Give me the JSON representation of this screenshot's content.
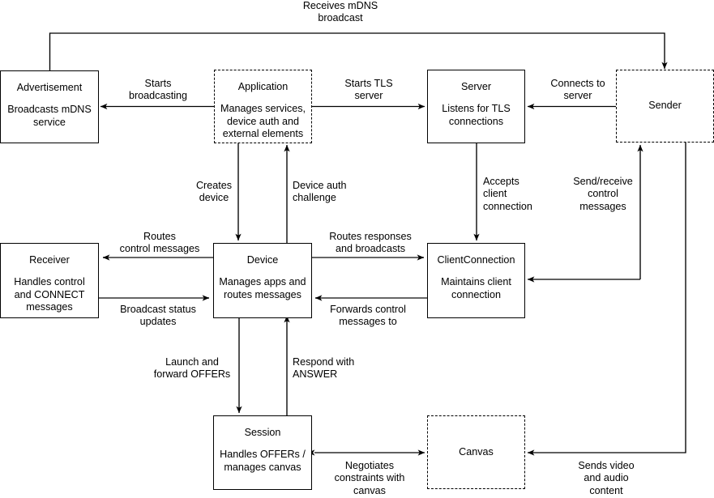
{
  "diagram": {
    "title": "Component interaction diagram",
    "colors": {
      "node_border": "#000000",
      "background": "#ffffff",
      "text": "#000000",
      "edge_black": "#000000",
      "edge_gray": "#666666"
    },
    "nodes": [
      {
        "id": "advertisement",
        "title": "Advertisement",
        "subtitle": "Broadcasts mDNS\nservice",
        "style": "solid"
      },
      {
        "id": "application",
        "title": "Application",
        "subtitle": "Manages services,\ndevice auth and\nexternal elements",
        "style": "dashed"
      },
      {
        "id": "server",
        "title": "Server",
        "subtitle": "Listens for TLS\nconnections",
        "style": "solid"
      },
      {
        "id": "sender",
        "title": "Sender",
        "subtitle": "",
        "style": "dashed"
      },
      {
        "id": "receiver",
        "title": "Receiver",
        "subtitle": "Handles control\nand CONNECT\nmessages",
        "style": "solid"
      },
      {
        "id": "device",
        "title": "Device",
        "subtitle": "Manages apps and\nroutes messages",
        "style": "solid"
      },
      {
        "id": "clientconnection",
        "title": "ClientConnection",
        "subtitle": "Maintains client\nconnection",
        "style": "solid"
      },
      {
        "id": "session",
        "title": "Session",
        "subtitle": "Handles OFFERs  /\nmanages canvas",
        "style": "solid"
      },
      {
        "id": "canvas",
        "title": "Canvas",
        "subtitle": "",
        "style": "dashed"
      }
    ],
    "edges": [
      {
        "id": "e1",
        "from": "advertisement",
        "to": "sender",
        "label": "Receives mDNS\nbroadcast"
      },
      {
        "id": "e2",
        "from": "application",
        "to": "advertisement",
        "label": "Starts\nbroadcasting"
      },
      {
        "id": "e3",
        "from": "application",
        "to": "server",
        "label": "Starts TLS\nserver"
      },
      {
        "id": "e4",
        "from": "sender",
        "to": "server",
        "label": "Connects to\nserver"
      },
      {
        "id": "e5",
        "from": "application",
        "to": "device",
        "label": "Creates\ndevice"
      },
      {
        "id": "e6",
        "from": "device",
        "to": "application",
        "label": "Device auth\nchallenge"
      },
      {
        "id": "e7",
        "from": "server",
        "to": "clientconnection",
        "label": "Accepts\nclient\nconnection"
      },
      {
        "id": "e8",
        "from": "clientconnection",
        "to": "sender",
        "label": "Send/receive\ncontrol\nmessages"
      },
      {
        "id": "e9",
        "from": "device",
        "to": "receiver",
        "label": "Routes\ncontrol messages"
      },
      {
        "id": "e10",
        "from": "receiver",
        "to": "device",
        "label": "Broadcast status\nupdates"
      },
      {
        "id": "e11",
        "from": "device",
        "to": "clientconnection",
        "label": "Routes responses\nand broadcasts"
      },
      {
        "id": "e12",
        "from": "clientconnection",
        "to": "device",
        "label": "Forwards control\nmessages to"
      },
      {
        "id": "e13",
        "from": "device",
        "to": "session",
        "label": "Launch and\nforward OFFERs"
      },
      {
        "id": "e14",
        "from": "session",
        "to": "device",
        "label": "Respond with\nANSWER"
      },
      {
        "id": "e15",
        "from": "session",
        "to": "canvas",
        "label": "Negotiates\nconstraints with\ncanvas"
      },
      {
        "id": "e16",
        "from": "sender",
        "to": "canvas",
        "label": "Sends video\nand audio\ncontent"
      }
    ]
  }
}
